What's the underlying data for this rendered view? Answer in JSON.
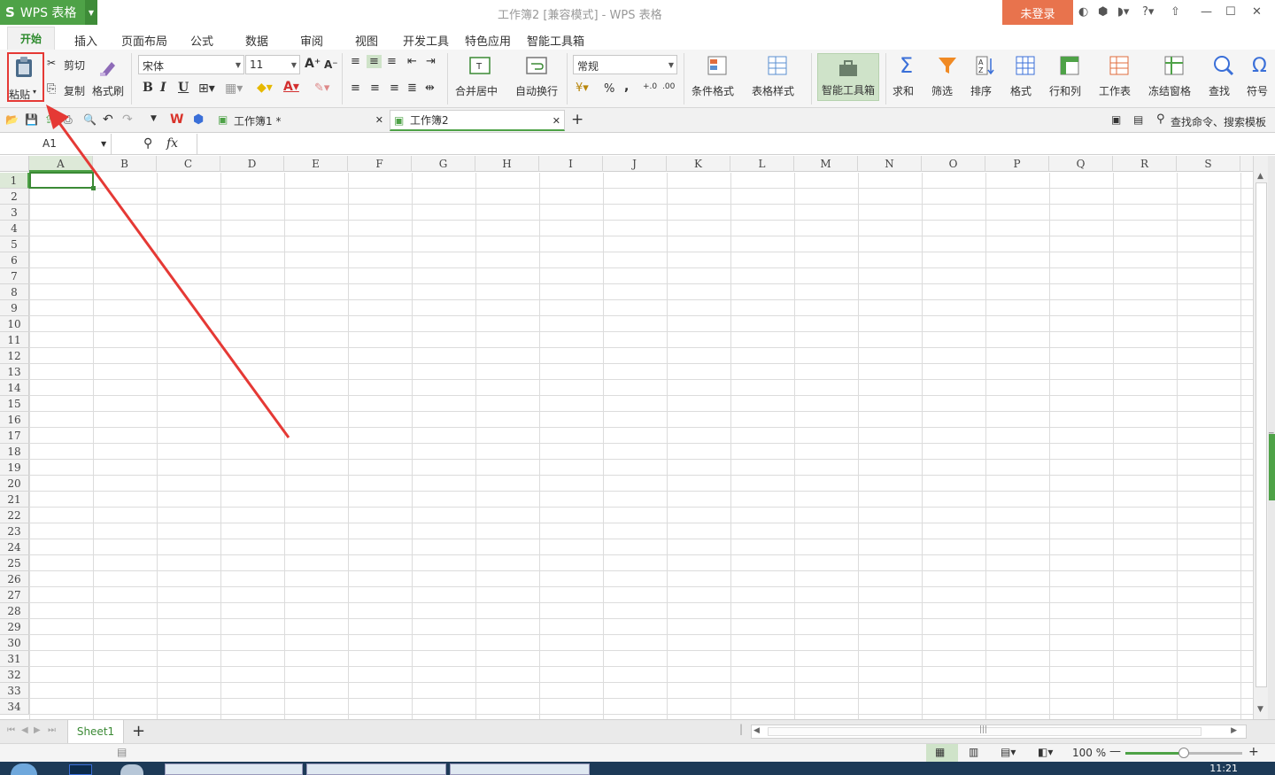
{
  "app": {
    "logo": "S",
    "name": "WPS 表格",
    "title": "工作簿2 [兼容模式] - WPS 表格",
    "login": "未登录"
  },
  "tabs": [
    "开始",
    "插入",
    "页面布局",
    "公式",
    "数据",
    "审阅",
    "视图",
    "开发工具",
    "特色应用",
    "智能工具箱"
  ],
  "ribbon": {
    "paste": "粘贴",
    "cut": "剪切",
    "copy": "复制",
    "format_painter": "格式刷",
    "font_name": "宋体",
    "font_size": "11",
    "merge_center": "合并居中",
    "wrap_text": "自动换行",
    "number_format": "常规",
    "cond_format": "条件格式",
    "table_style": "表格样式",
    "smart_toolbox": "智能工具箱",
    "sum": "求和",
    "filter": "筛选",
    "sort": "排序",
    "format": "格式",
    "row_col": "行和列",
    "worksheet": "工作表",
    "freeze": "冻结窗格",
    "find": "查找",
    "symbol": "符号",
    "bold": "B",
    "italic": "I",
    "underline": "U",
    "percent": "%",
    "comma": ","
  },
  "quickbar": {
    "doc1": "工作簿1 *",
    "doc2": "工作簿2",
    "search": "查找命令、搜索模板"
  },
  "formula": {
    "cell_ref": "A1",
    "fx": "fx",
    "value": ""
  },
  "columns": [
    "A",
    "B",
    "C",
    "D",
    "E",
    "F",
    "G",
    "H",
    "I",
    "J",
    "K",
    "L",
    "M",
    "N",
    "O",
    "P",
    "Q",
    "R",
    "S"
  ],
  "rows": [
    "1",
    "2",
    "3",
    "4",
    "5",
    "6",
    "7",
    "8",
    "9",
    "10",
    "11",
    "12",
    "13",
    "14",
    "15",
    "16",
    "17",
    "18",
    "19",
    "20",
    "21",
    "22",
    "23",
    "24",
    "25",
    "26",
    "27",
    "28",
    "29",
    "30",
    "31",
    "32",
    "33",
    "34"
  ],
  "sheets": {
    "active": "Sheet1",
    "add": "+"
  },
  "status": {
    "zoom": "100 %"
  },
  "taskbar": {
    "clock": "11:21"
  },
  "colors": {
    "brand": "#4ea247",
    "login": "#e8734d",
    "annotation": "#e53935"
  }
}
